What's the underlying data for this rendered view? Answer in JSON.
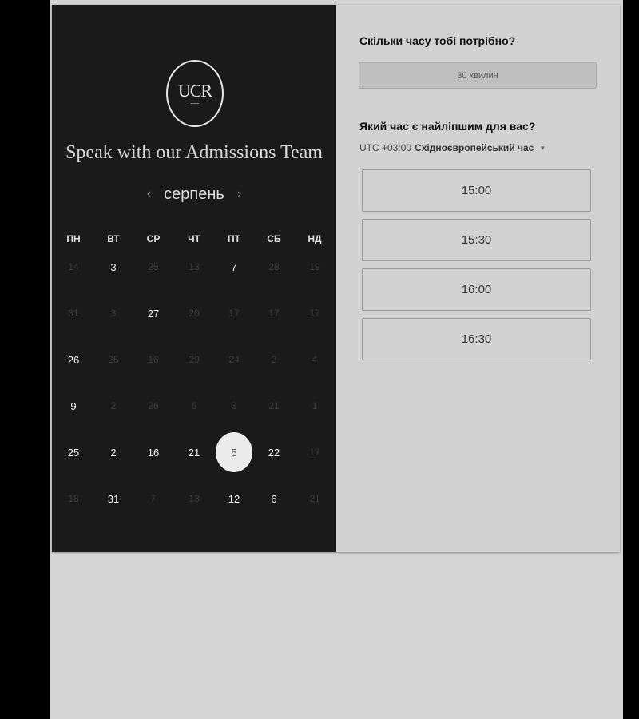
{
  "left": {
    "logo_text": "UCR",
    "title": "Speak with our Admissions Team",
    "month": "серпень",
    "prev_arrow": "‹",
    "next_arrow": "›",
    "weekdays": [
      "ПН",
      "ВТ",
      "СР",
      "ЧТ",
      "ПТ",
      "СБ",
      "НД"
    ],
    "weeks": [
      [
        {
          "d": "14",
          "s": "dim"
        },
        {
          "d": "3",
          "s": "avail"
        },
        {
          "d": "25",
          "s": "dim"
        },
        {
          "d": "13",
          "s": "dim"
        },
        {
          "d": "7",
          "s": "avail"
        },
        {
          "d": "28",
          "s": "dim"
        },
        {
          "d": "19",
          "s": "dim"
        }
      ],
      [
        {
          "d": "31",
          "s": "dim"
        },
        {
          "d": "3",
          "s": "dim"
        },
        {
          "d": "27",
          "s": "avail"
        },
        {
          "d": "20",
          "s": "dim"
        },
        {
          "d": "17",
          "s": "dim"
        },
        {
          "d": "17",
          "s": "dim"
        },
        {
          "d": "17",
          "s": "dim"
        }
      ],
      [
        {
          "d": "26",
          "s": "avail"
        },
        {
          "d": "25",
          "s": "dim"
        },
        {
          "d": "16",
          "s": "dim"
        },
        {
          "d": "29",
          "s": "dim"
        },
        {
          "d": "24",
          "s": "dim"
        },
        {
          "d": "2",
          "s": "dim"
        },
        {
          "d": "4",
          "s": "dim"
        }
      ],
      [
        {
          "d": "9",
          "s": "avail"
        },
        {
          "d": "2",
          "s": "dim"
        },
        {
          "d": "26",
          "s": "dim"
        },
        {
          "d": "6",
          "s": "dim"
        },
        {
          "d": "3",
          "s": "dim"
        },
        {
          "d": "21",
          "s": "dim"
        },
        {
          "d": "1",
          "s": "dim"
        }
      ],
      [
        {
          "d": "25",
          "s": "avail"
        },
        {
          "d": "2",
          "s": "avail"
        },
        {
          "d": "16",
          "s": "avail"
        },
        {
          "d": "21",
          "s": "avail"
        },
        {
          "d": "5",
          "s": "selected"
        },
        {
          "d": "22",
          "s": "avail"
        },
        {
          "d": "17",
          "s": "dim"
        }
      ],
      [
        {
          "d": "18",
          "s": "dim"
        },
        {
          "d": "31",
          "s": "avail"
        },
        {
          "d": "7",
          "s": "dim"
        },
        {
          "d": "13",
          "s": "dim"
        },
        {
          "d": "12",
          "s": "avail"
        },
        {
          "d": "6",
          "s": "avail"
        },
        {
          "d": "21",
          "s": "dim"
        }
      ]
    ]
  },
  "right": {
    "duration_question": "Скільки часу тобі потрібно?",
    "duration_value": "30 хвилин",
    "time_question": "Який час є найліпшим для вас?",
    "tz_offset": "UTC +03:00",
    "tz_name": "Східноєвропейський час",
    "tz_caret": "▼",
    "slots": [
      "15:00",
      "15:30",
      "16:00",
      "16:30"
    ]
  }
}
